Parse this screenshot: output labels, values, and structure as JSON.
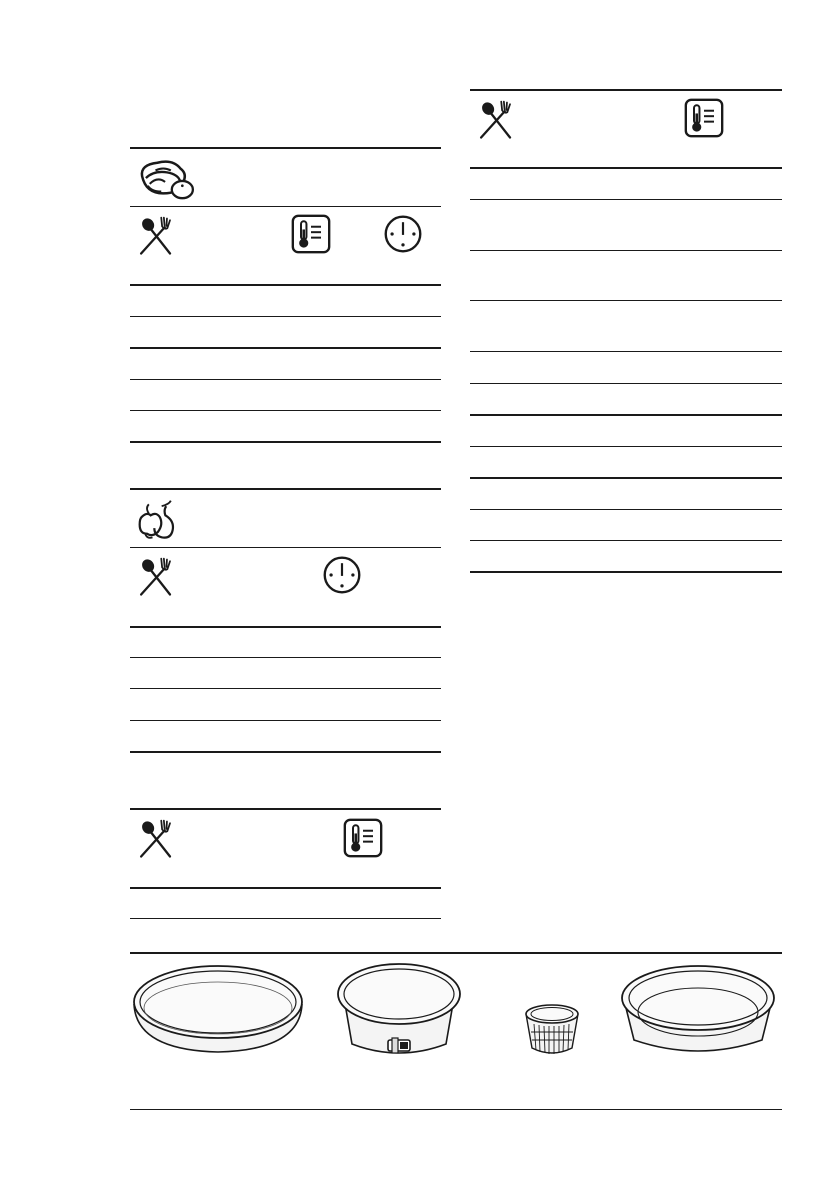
{
  "tables": [
    {
      "id": "meat",
      "category_icon": "meat-cuts-icon",
      "header_icons": [
        "cutlery-icon",
        "thermometer-icon",
        "clock-icon"
      ],
      "body_rows": 5
    },
    {
      "id": "fruit",
      "category_icon": "fruit-icon",
      "header_icons": [
        "cutlery-icon",
        "clock-icon"
      ],
      "body_rows": 4
    },
    {
      "id": "plain",
      "header_icons": [
        "cutlery-icon",
        "thermometer-icon"
      ],
      "body_rows": 1
    },
    {
      "id": "right",
      "header_icons": [
        "cutlery-icon",
        "thermometer-icon"
      ],
      "body_rows": 12
    }
  ],
  "bakeware": {
    "items": [
      "flan-tin-icon",
      "springform-tin-icon",
      "ramekin-icon",
      "deep-baking-tin-icon"
    ]
  },
  "colors": {
    "ink": "#1a1a1a",
    "rule": "#1a1a1a",
    "tin_fill": "#f4f4f4"
  }
}
